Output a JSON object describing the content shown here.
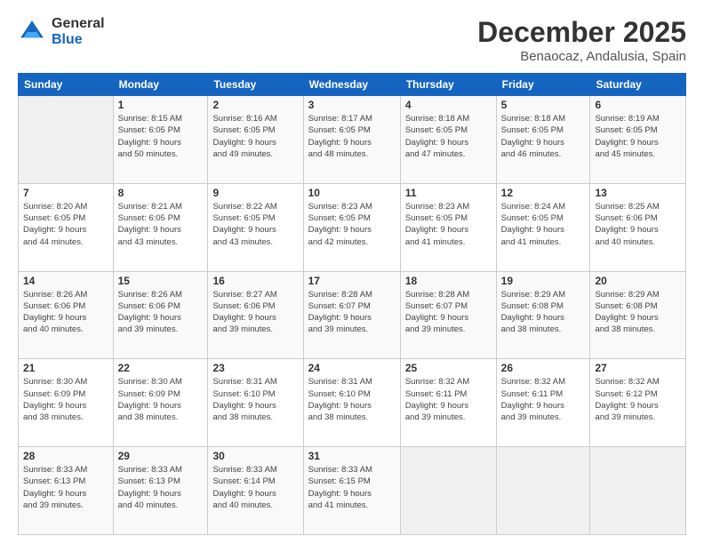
{
  "header": {
    "logo_general": "General",
    "logo_blue": "Blue",
    "month_title": "December 2025",
    "location": "Benaocaz, Andalusia, Spain"
  },
  "calendar": {
    "days_of_week": [
      "Sunday",
      "Monday",
      "Tuesday",
      "Wednesday",
      "Thursday",
      "Friday",
      "Saturday"
    ],
    "weeks": [
      [
        {
          "day": "",
          "info": ""
        },
        {
          "day": "1",
          "info": "Sunrise: 8:15 AM\nSunset: 6:05 PM\nDaylight: 9 hours\nand 50 minutes."
        },
        {
          "day": "2",
          "info": "Sunrise: 8:16 AM\nSunset: 6:05 PM\nDaylight: 9 hours\nand 49 minutes."
        },
        {
          "day": "3",
          "info": "Sunrise: 8:17 AM\nSunset: 6:05 PM\nDaylight: 9 hours\nand 48 minutes."
        },
        {
          "day": "4",
          "info": "Sunrise: 8:18 AM\nSunset: 6:05 PM\nDaylight: 9 hours\nand 47 minutes."
        },
        {
          "day": "5",
          "info": "Sunrise: 8:18 AM\nSunset: 6:05 PM\nDaylight: 9 hours\nand 46 minutes."
        },
        {
          "day": "6",
          "info": "Sunrise: 8:19 AM\nSunset: 6:05 PM\nDaylight: 9 hours\nand 45 minutes."
        }
      ],
      [
        {
          "day": "7",
          "info": "Sunrise: 8:20 AM\nSunset: 6:05 PM\nDaylight: 9 hours\nand 44 minutes."
        },
        {
          "day": "8",
          "info": "Sunrise: 8:21 AM\nSunset: 6:05 PM\nDaylight: 9 hours\nand 43 minutes."
        },
        {
          "day": "9",
          "info": "Sunrise: 8:22 AM\nSunset: 6:05 PM\nDaylight: 9 hours\nand 43 minutes."
        },
        {
          "day": "10",
          "info": "Sunrise: 8:23 AM\nSunset: 6:05 PM\nDaylight: 9 hours\nand 42 minutes."
        },
        {
          "day": "11",
          "info": "Sunrise: 8:23 AM\nSunset: 6:05 PM\nDaylight: 9 hours\nand 41 minutes."
        },
        {
          "day": "12",
          "info": "Sunrise: 8:24 AM\nSunset: 6:05 PM\nDaylight: 9 hours\nand 41 minutes."
        },
        {
          "day": "13",
          "info": "Sunrise: 8:25 AM\nSunset: 6:06 PM\nDaylight: 9 hours\nand 40 minutes."
        }
      ],
      [
        {
          "day": "14",
          "info": "Sunrise: 8:26 AM\nSunset: 6:06 PM\nDaylight: 9 hours\nand 40 minutes."
        },
        {
          "day": "15",
          "info": "Sunrise: 8:26 AM\nSunset: 6:06 PM\nDaylight: 9 hours\nand 39 minutes."
        },
        {
          "day": "16",
          "info": "Sunrise: 8:27 AM\nSunset: 6:06 PM\nDaylight: 9 hours\nand 39 minutes."
        },
        {
          "day": "17",
          "info": "Sunrise: 8:28 AM\nSunset: 6:07 PM\nDaylight: 9 hours\nand 39 minutes."
        },
        {
          "day": "18",
          "info": "Sunrise: 8:28 AM\nSunset: 6:07 PM\nDaylight: 9 hours\nand 39 minutes."
        },
        {
          "day": "19",
          "info": "Sunrise: 8:29 AM\nSunset: 6:08 PM\nDaylight: 9 hours\nand 38 minutes."
        },
        {
          "day": "20",
          "info": "Sunrise: 8:29 AM\nSunset: 6:08 PM\nDaylight: 9 hours\nand 38 minutes."
        }
      ],
      [
        {
          "day": "21",
          "info": "Sunrise: 8:30 AM\nSunset: 6:09 PM\nDaylight: 9 hours\nand 38 minutes."
        },
        {
          "day": "22",
          "info": "Sunrise: 8:30 AM\nSunset: 6:09 PM\nDaylight: 9 hours\nand 38 minutes."
        },
        {
          "day": "23",
          "info": "Sunrise: 8:31 AM\nSunset: 6:10 PM\nDaylight: 9 hours\nand 38 minutes."
        },
        {
          "day": "24",
          "info": "Sunrise: 8:31 AM\nSunset: 6:10 PM\nDaylight: 9 hours\nand 38 minutes."
        },
        {
          "day": "25",
          "info": "Sunrise: 8:32 AM\nSunset: 6:11 PM\nDaylight: 9 hours\nand 39 minutes."
        },
        {
          "day": "26",
          "info": "Sunrise: 8:32 AM\nSunset: 6:11 PM\nDaylight: 9 hours\nand 39 minutes."
        },
        {
          "day": "27",
          "info": "Sunrise: 8:32 AM\nSunset: 6:12 PM\nDaylight: 9 hours\nand 39 minutes."
        }
      ],
      [
        {
          "day": "28",
          "info": "Sunrise: 8:33 AM\nSunset: 6:13 PM\nDaylight: 9 hours\nand 39 minutes."
        },
        {
          "day": "29",
          "info": "Sunrise: 8:33 AM\nSunset: 6:13 PM\nDaylight: 9 hours\nand 40 minutes."
        },
        {
          "day": "30",
          "info": "Sunrise: 8:33 AM\nSunset: 6:14 PM\nDaylight: 9 hours\nand 40 minutes."
        },
        {
          "day": "31",
          "info": "Sunrise: 8:33 AM\nSunset: 6:15 PM\nDaylight: 9 hours\nand 41 minutes."
        },
        {
          "day": "",
          "info": ""
        },
        {
          "day": "",
          "info": ""
        },
        {
          "day": "",
          "info": ""
        }
      ]
    ]
  }
}
